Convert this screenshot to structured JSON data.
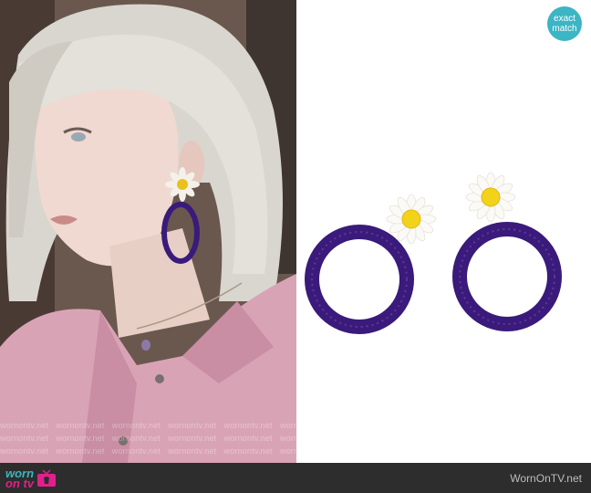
{
  "badge": {
    "line1": "exact",
    "line2": "match"
  },
  "watermark": "wornontv.net",
  "footer": {
    "logo_line1": "worn",
    "logo_line2": "on tv",
    "site": "WornOnTV.net"
  },
  "colors": {
    "accent": "#3cb5c4",
    "logo_pink": "#e0218a",
    "footer_bg": "#2d2d2d",
    "hoop_purple": "#3a1a7a",
    "daisy_center": "#f3d21a"
  }
}
